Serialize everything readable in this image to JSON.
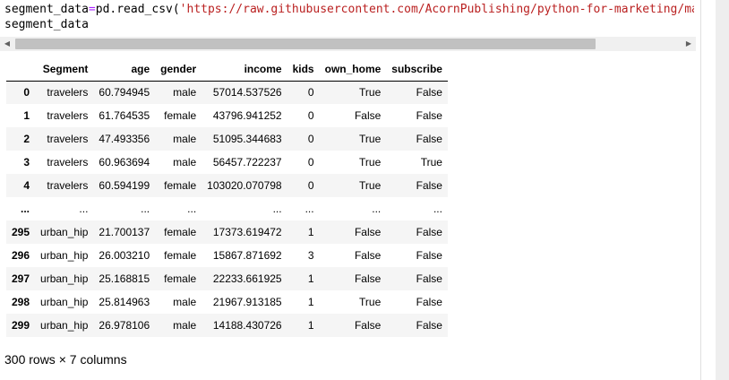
{
  "code": {
    "line1_var": "segment_data",
    "line1_eq": "=",
    "line1_call": "pd.read_csv(",
    "line1_str": "'https://raw.githubusercontent.com/AcornPublishing/python-for-marketing/main/Data/cha",
    "line2": "segment_data"
  },
  "scrollbar": {
    "left_icon": "scroll-left-arrow-icon",
    "right_icon": "scroll-right-arrow-icon"
  },
  "table": {
    "index_header": "",
    "columns": [
      "Segment",
      "age",
      "gender",
      "income",
      "kids",
      "own_home",
      "subscribe"
    ],
    "rows": [
      {
        "index": "0",
        "cells": [
          "travelers",
          "60.794945",
          "male",
          "57014.537526",
          "0",
          "True",
          "False"
        ]
      },
      {
        "index": "1",
        "cells": [
          "travelers",
          "61.764535",
          "female",
          "43796.941252",
          "0",
          "False",
          "False"
        ]
      },
      {
        "index": "2",
        "cells": [
          "travelers",
          "47.493356",
          "male",
          "51095.344683",
          "0",
          "True",
          "False"
        ]
      },
      {
        "index": "3",
        "cells": [
          "travelers",
          "60.963694",
          "male",
          "56457.722237",
          "0",
          "True",
          "True"
        ]
      },
      {
        "index": "4",
        "cells": [
          "travelers",
          "60.594199",
          "female",
          "103020.070798",
          "0",
          "True",
          "False"
        ]
      },
      {
        "index": "...",
        "cells": [
          "...",
          "...",
          "...",
          "...",
          "...",
          "...",
          "..."
        ]
      },
      {
        "index": "295",
        "cells": [
          "urban_hip",
          "21.700137",
          "female",
          "17373.619472",
          "1",
          "False",
          "False"
        ]
      },
      {
        "index": "296",
        "cells": [
          "urban_hip",
          "26.003210",
          "female",
          "15867.871692",
          "3",
          "False",
          "False"
        ]
      },
      {
        "index": "297",
        "cells": [
          "urban_hip",
          "25.168815",
          "female",
          "22233.661925",
          "1",
          "False",
          "False"
        ]
      },
      {
        "index": "298",
        "cells": [
          "urban_hip",
          "25.814963",
          "male",
          "21967.913185",
          "1",
          "True",
          "False"
        ]
      },
      {
        "index": "299",
        "cells": [
          "urban_hip",
          "26.978106",
          "male",
          "14188.430726",
          "1",
          "False",
          "False"
        ]
      }
    ]
  },
  "summary": "300 rows × 7 columns"
}
